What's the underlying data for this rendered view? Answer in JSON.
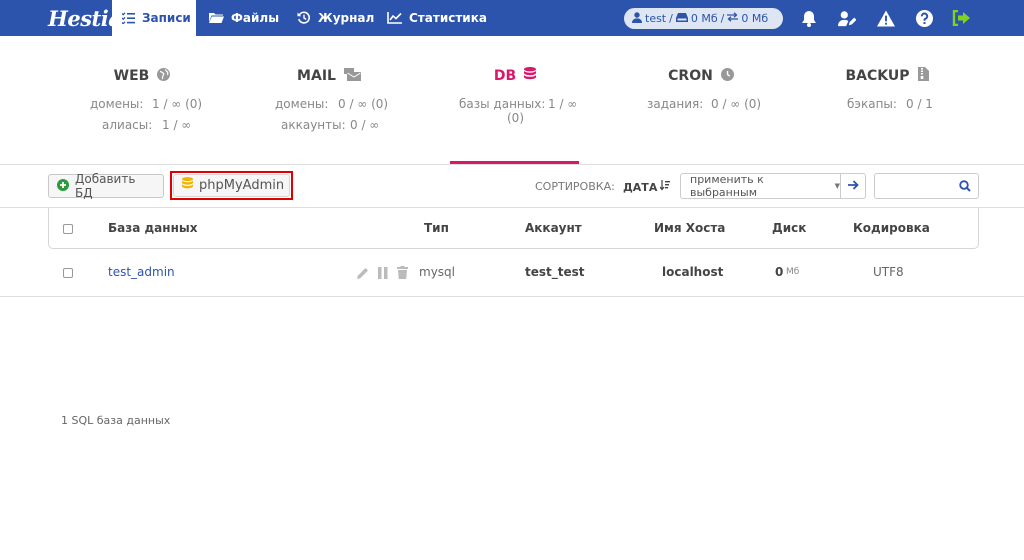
{
  "brand": {
    "logo_text": "Hestia"
  },
  "nav": {
    "tabs": [
      {
        "label": "Записи",
        "icon": "list-check-icon"
      },
      {
        "label": "Файлы",
        "icon": "folder-icon"
      },
      {
        "label": "Журнал",
        "icon": "history-icon"
      },
      {
        "label": "Статистика",
        "icon": "chart-line-icon"
      }
    ],
    "user": {
      "name": "test",
      "disk": "0 Мб",
      "bandwidth": "0 Мб",
      "sep": "/"
    }
  },
  "stats": {
    "web": {
      "title": "WEB",
      "rows": [
        {
          "label": "домены:",
          "value": "1 / ∞ (0)"
        },
        {
          "label": "алиасы:",
          "value": "1 / ∞"
        }
      ]
    },
    "mail": {
      "title": "MAIL",
      "rows": [
        {
          "label": "домены:",
          "value": "0 / ∞ (0)"
        },
        {
          "label": "аккаунты:",
          "value": "0 / ∞"
        }
      ]
    },
    "db": {
      "title": "DB",
      "rows": [
        {
          "label": "базы данных:",
          "value": "1 / ∞",
          "value2": "(0)"
        }
      ]
    },
    "cron": {
      "title": "CRON",
      "rows": [
        {
          "label": "задания:",
          "value": "0 / ∞ (0)"
        }
      ]
    },
    "backup": {
      "title": "BACKUP",
      "rows": [
        {
          "label": "бэкапы:",
          "value": "0 / 1"
        }
      ]
    }
  },
  "toolbar": {
    "add_db": "Добавить БД",
    "phpmyadmin": "phpMyAdmin",
    "sort_label": "СОРТИРОВКА:",
    "sort_value": "ДАТА",
    "apply_label": "применить к выбранным",
    "search_placeholder": ""
  },
  "table": {
    "headers": [
      "База данных",
      "Тип",
      "Аккаунт",
      "Имя Хоста",
      "Диск",
      "Кодировка"
    ],
    "rows": [
      {
        "name": "test_admin",
        "type": "mysql",
        "account": "test_test",
        "host": "localhost",
        "disk": "0",
        "disk_unit": "Мб",
        "encoding": "UTF8"
      }
    ]
  },
  "footer": {
    "summary": "1 SQL база данных"
  },
  "colors": {
    "nav": "#2c54ac",
    "accent": "#d8186a",
    "highlight": "#e00000",
    "logout": "#7ed321"
  }
}
